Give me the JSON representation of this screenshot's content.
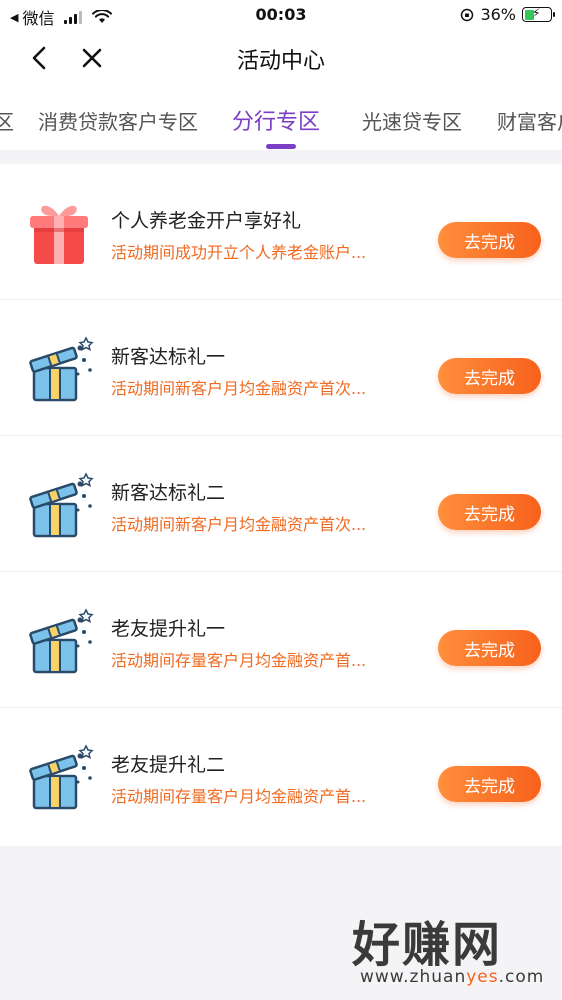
{
  "status_bar": {
    "carrier": "微信",
    "time": "00:03",
    "battery": "36%"
  },
  "nav": {
    "title": "活动中心"
  },
  "tabs": [
    {
      "label": "区",
      "active": false
    },
    {
      "label": "消费贷款客户专区",
      "active": false
    },
    {
      "label": "分行专区",
      "active": true
    },
    {
      "label": "光速贷专区",
      "active": false
    },
    {
      "label": "财富客户",
      "active": false
    }
  ],
  "items": [
    {
      "title": "个人养老金开户享好礼",
      "desc": "活动期间成功开立个人养老金账户...",
      "button": "去完成",
      "icon": "red-gift-box-icon"
    },
    {
      "title": "新客达标礼一",
      "desc": "活动期间新客户月均金融资产首次...",
      "button": "去完成",
      "icon": "open-gift-box-icon"
    },
    {
      "title": "新客达标礼二",
      "desc": "活动期间新客户月均金融资产首次...",
      "button": "去完成",
      "icon": "open-gift-box-icon"
    },
    {
      "title": "老友提升礼一",
      "desc": "活动期间存量客户月均金融资产首...",
      "button": "去完成",
      "icon": "open-gift-box-icon"
    },
    {
      "title": "老友提升礼二",
      "desc": "活动期间存量客户月均金融资产首...",
      "button": "去完成",
      "icon": "open-gift-box-icon"
    }
  ],
  "watermark": {
    "text": "好赚网",
    "url_prefix": "www.zhuan",
    "url_highlight": "yes",
    "url_suffix": ".com"
  },
  "colors": {
    "accent": "#7a3fc5",
    "button": "#f7611c",
    "desc": "#f06a21"
  }
}
